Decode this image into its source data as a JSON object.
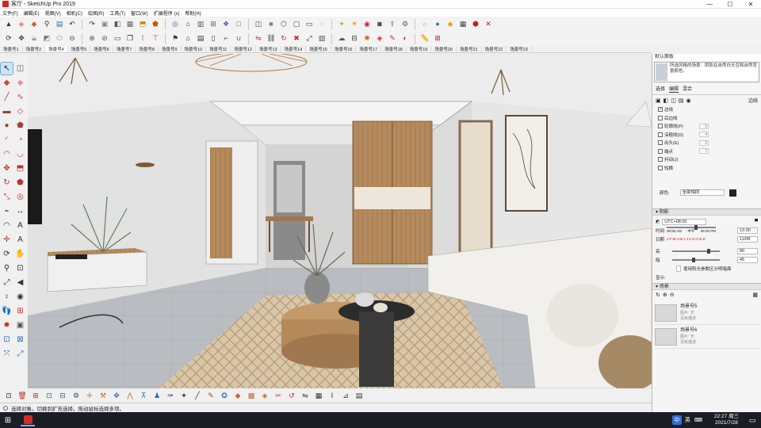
{
  "window": {
    "title": "客厅 - SketchUp Pro 2019",
    "controls": [
      "—",
      "☐",
      "✕"
    ]
  },
  "menu": [
    "文件(F)",
    "编辑(E)",
    "视图(V)",
    "相机(C)",
    "绘图(R)",
    "工具(T)",
    "窗口(W)",
    "扩展程序 (x)",
    "帮助(H)"
  ],
  "toolbar_row1": [
    {
      "name": "select-icon",
      "glyph": "▲",
      "color": "#333"
    },
    {
      "name": "eraser-icon",
      "glyph": "◈",
      "color": "#e07080"
    },
    {
      "name": "paint-bucket-icon",
      "glyph": "◆",
      "color": "#d06030"
    },
    {
      "name": "zoom-icon",
      "glyph": "⚲",
      "color": "#333"
    },
    {
      "name": "save-icon",
      "glyph": "▤",
      "color": "#3a6ea5"
    },
    {
      "name": "undo-icon",
      "glyph": "↶",
      "color": "#333"
    },
    {
      "name": "redo-icon",
      "glyph": "↷",
      "color": "#333"
    },
    {
      "name": "box-icon",
      "glyph": "▣",
      "color": "#888"
    },
    {
      "name": "component-icon",
      "glyph": "◧",
      "color": "#555"
    },
    {
      "name": "group-icon",
      "glyph": "▦",
      "color": "#666"
    },
    {
      "name": "push-pull-icon",
      "glyph": "⬒",
      "color": "#d08020"
    },
    {
      "name": "follow-me-icon",
      "glyph": "⬟",
      "color": "#cc5500"
    },
    {
      "name": "offset-icon",
      "glyph": "◎",
      "color": "#2a6eb0"
    },
    {
      "name": "warehouse-icon",
      "glyph": "⌂",
      "color": "#333"
    },
    {
      "name": "layer-icon",
      "glyph": "▥",
      "color": "#555"
    },
    {
      "name": "section-icon",
      "glyph": "⊞",
      "color": "#2a8a3a"
    },
    {
      "name": "style-icon",
      "glyph": "❖",
      "color": "#7a3ea5"
    },
    {
      "name": "hidden-line-icon",
      "glyph": "□",
      "color": "#555"
    },
    {
      "name": "wire-icon",
      "glyph": "◫",
      "color": "#555"
    },
    {
      "name": "shaded-icon",
      "glyph": "■",
      "color": "#6a8ab0"
    },
    {
      "name": "iso-icon",
      "glyph": "⬡",
      "color": "#444"
    },
    {
      "name": "top-view-icon",
      "glyph": "▢",
      "color": "#444"
    },
    {
      "name": "front-view-icon",
      "glyph": "▭",
      "color": "#444"
    },
    {
      "name": "xray-icon",
      "glyph": "◌",
      "color": "#777"
    },
    {
      "name": "render-icon",
      "glyph": "✦",
      "color": "#e4a010"
    },
    {
      "name": "light-icon",
      "glyph": "☀",
      "color": "#e09000"
    },
    {
      "name": "material-icon",
      "glyph": "◉",
      "color": "#c03030"
    },
    {
      "name": "camera-icon",
      "glyph": "◙",
      "color": "#333"
    },
    {
      "name": "export-icon",
      "glyph": "⇪",
      "color": "#2a6eb0"
    },
    {
      "name": "settings-icon",
      "glyph": "⚙",
      "color": "#555"
    },
    {
      "name": "sun-icon",
      "glyph": "☼",
      "color": "#e0a000"
    },
    {
      "name": "sphere-icon",
      "glyph": "●",
      "color": "#3070c0"
    },
    {
      "name": "cube-icon",
      "glyph": "◆",
      "color": "#f0a020"
    },
    {
      "name": "grid-icon",
      "glyph": "▦",
      "color": "#444"
    },
    {
      "name": "tag-icon",
      "glyph": "⬢",
      "color": "#c02020"
    },
    {
      "name": "close-icon",
      "glyph": "✕",
      "color": "#c02020"
    }
  ],
  "toolbar_row2": [
    {
      "name": "orbit-icon",
      "glyph": "⟳",
      "color": "#333"
    },
    {
      "name": "pan-icon",
      "glyph": "✥",
      "color": "#333"
    },
    {
      "name": "teapot-icon",
      "glyph": "☕",
      "color": "#444"
    },
    {
      "name": "solid-icon",
      "glyph": "◩",
      "color": "#777"
    },
    {
      "name": "cylinder-icon",
      "glyph": "⬭",
      "color": "#888"
    },
    {
      "name": "subtract-icon",
      "glyph": "⊖",
      "color": "#555"
    },
    {
      "name": "union-icon",
      "glyph": "⊕",
      "color": "#555"
    },
    {
      "name": "split-icon",
      "glyph": "⊘",
      "color": "#555"
    },
    {
      "name": "window-icon",
      "glyph": "▭",
      "color": "#333"
    },
    {
      "name": "copy-icon",
      "glyph": "❐",
      "color": "#333"
    },
    {
      "name": "array-icon",
      "glyph": "⁞",
      "color": "#333"
    },
    {
      "name": "table-icon",
      "glyph": "⊤",
      "color": "#a05010"
    },
    {
      "name": "flag-icon",
      "glyph": "⚑",
      "color": "#333"
    },
    {
      "name": "house-icon",
      "glyph": "⌂",
      "color": "#333"
    },
    {
      "name": "wall-icon",
      "glyph": "▤",
      "color": "#333"
    },
    {
      "name": "door-icon",
      "glyph": "▯",
      "color": "#333"
    },
    {
      "name": "stairs-icon",
      "glyph": "⌐",
      "color": "#333"
    },
    {
      "name": "magnet-icon",
      "glyph": "∪",
      "color": "#2a6eb0"
    },
    {
      "name": "mirror-icon",
      "glyph": "⇋",
      "color": "#c03030"
    },
    {
      "name": "link-icon",
      "glyph": "⛓",
      "color": "#333"
    },
    {
      "name": "rotate-icon",
      "glyph": "↻",
      "color": "#c03030"
    },
    {
      "name": "trash-icon",
      "glyph": "✖",
      "color": "#c03030"
    },
    {
      "name": "scale-icon",
      "glyph": "⤢",
      "color": "#333"
    },
    {
      "name": "photo-icon",
      "glyph": "▨",
      "color": "#555"
    },
    {
      "name": "cloud-icon",
      "glyph": "☁",
      "color": "#555"
    },
    {
      "name": "align-icon",
      "glyph": "⊟",
      "color": "#333"
    },
    {
      "name": "fire-icon",
      "glyph": "✺",
      "color": "#e06010"
    },
    {
      "name": "stamp-icon",
      "glyph": "◈",
      "color": "#c03030"
    },
    {
      "name": "brush-icon",
      "glyph": "✎",
      "color": "#c03030"
    },
    {
      "name": "bottle-icon",
      "glyph": "◐",
      "color": "#c03030"
    },
    {
      "name": "ruler-icon",
      "glyph": "📏",
      "color": "#333"
    },
    {
      "name": "delete-tag-icon",
      "glyph": "⊠",
      "color": "#c03030"
    }
  ],
  "scenes": [
    "场景号1",
    "场景号2",
    "场景号4",
    "场景号5",
    "场景号6",
    "场景号7",
    "场景号8",
    "场景号9",
    "场景号10",
    "场景号11",
    "场景号12",
    "场景号13",
    "场景号14",
    "场景号15",
    "场景号16",
    "场景号17",
    "场景号18",
    "场景号19",
    "场景号20",
    "场景号21",
    "场景号22",
    "场景号23"
  ],
  "active_scene_index": 2,
  "left_tools": [
    {
      "name": "select-tool-icon",
      "glyph": "↖",
      "color": "#222",
      "sel": true
    },
    {
      "name": "make-component-icon",
      "glyph": "◫",
      "color": "#666"
    },
    {
      "name": "paint-tool-icon",
      "glyph": "◆",
      "color": "#c05020"
    },
    {
      "name": "eraser-tool-icon",
      "glyph": "◈",
      "color": "#e07080"
    },
    {
      "name": "line-tool-icon",
      "glyph": "╱",
      "color": "#c03030"
    },
    {
      "name": "freehand-tool-icon",
      "glyph": "∿",
      "color": "#c03030"
    },
    {
      "name": "rectangle-tool-icon",
      "glyph": "▬",
      "color": "#a04040"
    },
    {
      "name": "rotated-rect-icon",
      "glyph": "◇",
      "color": "#a04040"
    },
    {
      "name": "circle-tool-icon",
      "glyph": "●",
      "color": "#a04040"
    },
    {
      "name": "polygon-tool-icon",
      "glyph": "⬟",
      "color": "#a04040"
    },
    {
      "name": "arc-tool-icon",
      "glyph": "◜",
      "color": "#c03030"
    },
    {
      "name": "pie-tool-icon",
      "glyph": "◔",
      "color": "#c03030"
    },
    {
      "name": "arc2-tool-icon",
      "glyph": "◠",
      "color": "#c03030"
    },
    {
      "name": "arc3-tool-icon",
      "glyph": "◡",
      "color": "#c03030"
    },
    {
      "name": "move-tool-icon",
      "glyph": "✥",
      "color": "#c03030"
    },
    {
      "name": "push-pull-tool-icon",
      "glyph": "⬒",
      "color": "#c03030"
    },
    {
      "name": "rotate-tool-icon",
      "glyph": "↻",
      "color": "#c03030"
    },
    {
      "name": "follow-me-tool-icon",
      "glyph": "⬟",
      "color": "#c03030"
    },
    {
      "name": "scale-tool-icon",
      "glyph": "⤡",
      "color": "#c03030"
    },
    {
      "name": "offset-tool-icon",
      "glyph": "◎",
      "color": "#c03030"
    },
    {
      "name": "tape-tool-icon",
      "glyph": "⌁",
      "color": "#333"
    },
    {
      "name": "dimension-tool-icon",
      "glyph": "↔",
      "color": "#333"
    },
    {
      "name": "protractor-tool-icon",
      "glyph": "◠",
      "color": "#333"
    },
    {
      "name": "text-tool-icon",
      "glyph": "A",
      "color": "#333"
    },
    {
      "name": "axes-tool-icon",
      "glyph": "✛",
      "color": "#c03030"
    },
    {
      "name": "3d-text-tool-icon",
      "glyph": "A",
      "color": "#333"
    },
    {
      "name": "orbit-tool-icon",
      "glyph": "⟳",
      "color": "#333"
    },
    {
      "name": "pan-tool-icon",
      "glyph": "✋",
      "color": "#333"
    },
    {
      "name": "zoom-tool-icon",
      "glyph": "⚲",
      "color": "#333"
    },
    {
      "name": "zoom-window-icon",
      "glyph": "⊡",
      "color": "#333"
    },
    {
      "name": "zoom-extents-icon",
      "glyph": "⤢",
      "color": "#333"
    },
    {
      "name": "previous-view-icon",
      "glyph": "◀",
      "color": "#333"
    },
    {
      "name": "position-camera-icon",
      "glyph": "♀",
      "color": "#333"
    },
    {
      "name": "look-around-icon",
      "glyph": "◉",
      "color": "#333"
    },
    {
      "name": "walk-tool-icon",
      "glyph": "👣",
      "color": "#333"
    },
    {
      "name": "section-plane-icon",
      "glyph": "⊞",
      "color": "#c03030"
    },
    {
      "name": "sandbox-icon",
      "glyph": "✸",
      "color": "#c03030"
    },
    {
      "name": "extra-tool-icon",
      "glyph": "▣",
      "color": "#555"
    },
    {
      "name": "dynamic-icon",
      "glyph": "⊡",
      "color": "#2a6eb0"
    },
    {
      "name": "dynamic2-icon",
      "glyph": "⊠",
      "color": "#2a6eb0"
    },
    {
      "name": "scale-fit-icon",
      "glyph": "⤧",
      "color": "#2a6eb0"
    },
    {
      "name": "fit-icon",
      "glyph": "⤢",
      "color": "#2a6eb0"
    }
  ],
  "bottom_tools": [
    {
      "name": "component-bottom-icon",
      "glyph": "⊡",
      "color": "#333"
    },
    {
      "name": "delete-bottom-icon",
      "glyph": "🗑",
      "color": "#c03030"
    },
    {
      "name": "move-bottom-icon",
      "glyph": "⊞",
      "color": "#c03030"
    },
    {
      "name": "copy-bottom-icon",
      "glyph": "⊡",
      "color": "#2a6eb0"
    },
    {
      "name": "paste-bottom-icon",
      "glyph": "⊟",
      "color": "#2a6eb0"
    },
    {
      "name": "settings-bottom-icon",
      "glyph": "⚙",
      "color": "#444"
    },
    {
      "name": "axes-bottom-icon",
      "glyph": "✛",
      "color": "#c07020"
    },
    {
      "name": "tools-bottom-icon",
      "glyph": "⚒",
      "color": "#c07020"
    },
    {
      "name": "move2-bottom-icon",
      "glyph": "✥",
      "color": "#2a6eb0"
    },
    {
      "name": "wall-bottom-icon",
      "glyph": "⋀",
      "color": "#c07020"
    },
    {
      "name": "stair-bottom-icon",
      "glyph": "⊼",
      "color": "#2a6eb0"
    },
    {
      "name": "person-bottom-icon",
      "glyph": "♟",
      "color": "#2a6eb0"
    },
    {
      "name": "knife-bottom-icon",
      "glyph": "✑",
      "color": "#333"
    },
    {
      "name": "magic-bottom-icon",
      "glyph": "✦",
      "color": "#333"
    },
    {
      "name": "pencil-bottom-icon",
      "glyph": "╱",
      "color": "#333"
    },
    {
      "name": "brush-bottom-icon",
      "glyph": "✎",
      "color": "#a05010"
    },
    {
      "name": "spray-bottom-icon",
      "glyph": "✪",
      "color": "#2a6eb0"
    },
    {
      "name": "material-bottom-icon",
      "glyph": "◆",
      "color": "#d06030"
    },
    {
      "name": "texture-bottom-icon",
      "glyph": "▩",
      "color": "#d06030"
    },
    {
      "name": "fill-bottom-icon",
      "glyph": "◈",
      "color": "#d06030"
    },
    {
      "name": "cut-bottom-icon",
      "glyph": "✂",
      "color": "#c03030"
    },
    {
      "name": "rotate-bottom-icon",
      "glyph": "↺",
      "color": "#c03030"
    },
    {
      "name": "flip-bottom-icon",
      "glyph": "⇋",
      "color": "#333"
    },
    {
      "name": "table-bottom-icon",
      "glyph": "▦",
      "color": "#333"
    },
    {
      "name": "text-bottom-icon",
      "glyph": "Ⅰ",
      "color": "#333"
    },
    {
      "name": "measure-bottom-icon",
      "glyph": "⊿",
      "color": "#333"
    },
    {
      "name": "chart-bottom-icon",
      "glyph": "▤",
      "color": "#333"
    }
  ],
  "status": {
    "text": "选择对象。切换到扩充选择。拖动鼠标选择多项。"
  },
  "taskbar": {
    "ime": "中",
    "ime2": "英",
    "time": "22:27 周三",
    "date": "2021/7/28"
  },
  "panel": {
    "header": "默认面板",
    "style_desc": "所选风格的场景：阴影在自然白天空和自然背景颜色。",
    "tabs": [
      "选择",
      "编辑",
      "混合"
    ],
    "edges_label": "边线",
    "edge_options": [
      {
        "label": "边线",
        "checked": true,
        "value": ""
      },
      {
        "label": "后边线",
        "checked": false,
        "value": ""
      },
      {
        "label": "轮廓线(P)",
        "checked": false,
        "value": "2"
      },
      {
        "label": "深粗线(D)",
        "checked": false,
        "value": "4"
      },
      {
        "label": "出头(E)",
        "checked": false,
        "value": "2"
      },
      {
        "label": "端点",
        "checked": false,
        "value": "7"
      },
      {
        "label": "抖动(J)",
        "checked": false,
        "value": ""
      },
      {
        "label": "短横",
        "checked": false,
        "value": ""
      }
    ],
    "color_label": "颜色:",
    "color_value": "全部相同",
    "shadow_section": "阴影",
    "timezone": "UTC+08:00",
    "time_label": "时间",
    "date_label": "日期",
    "time_start": "06:55 AM",
    "time_mid": "中午",
    "time_end": "05:00 PM",
    "time_value": "13:30",
    "month_scale": "J F M A M J J A S O N D",
    "date_value": "11/08",
    "light_label": "亮",
    "light_value": "80",
    "dark_label": "暗",
    "dark_value": "45",
    "sun_shade_label": "使用阳光参数区分明暗面",
    "display_label": "显示:",
    "scenes_section": "场景",
    "scene_items": [
      {
        "name": "场景号5",
        "sub": "图片: 无",
        "note": "没有描述"
      },
      {
        "name": "场景号6",
        "sub": "图片: 无",
        "note": "没有描述"
      }
    ]
  }
}
